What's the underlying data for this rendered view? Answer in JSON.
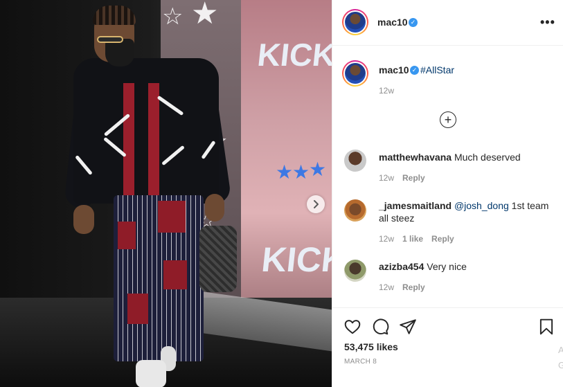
{
  "post": {
    "author": {
      "username": "mac10",
      "verified": true,
      "avatar_icon": "profile-avatar"
    },
    "more_icon": "•••",
    "caption": {
      "username": "mac10",
      "hashtag": "#AllStar",
      "time": "12w"
    },
    "photo": {
      "kicks_text_top": "KICKS",
      "kicks_text_bottom": "KICKS",
      "next_icon": "›"
    },
    "load_more_icon": "+",
    "comments": [
      {
        "username": "matthewhavana",
        "text": "Much deserved",
        "mention": "",
        "rest": "",
        "time": "12w",
        "likes": "",
        "reply": "Reply"
      },
      {
        "username": "_jamesmaitland",
        "text": "",
        "mention": "@josh_dong",
        "rest": " 1st team all steez",
        "time": "12w",
        "likes": "1 like",
        "reply": "Reply"
      },
      {
        "username": "azizba454",
        "text": "Very nice",
        "mention": "",
        "rest": "",
        "time": "12w",
        "likes": "",
        "reply": "Reply"
      }
    ],
    "likes_count": "53,475 likes",
    "date": "MARCH 8",
    "edge_text": [
      "A",
      "G"
    ]
  },
  "colors": {
    "link": "#00376b",
    "muted": "#8e8e8e",
    "verified": "#3897f0",
    "text": "#262626",
    "border": "#efefef"
  }
}
